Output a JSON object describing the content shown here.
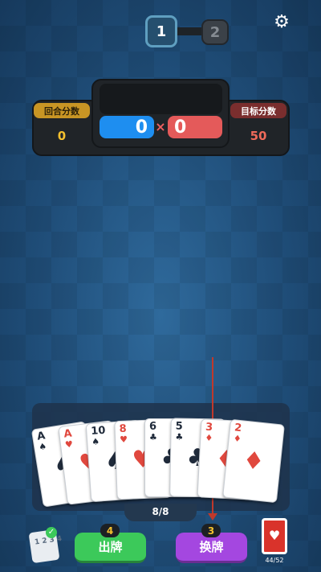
{
  "level": {
    "current": "1",
    "next": "2"
  },
  "settings": {
    "icon": "gear-icon"
  },
  "score": {
    "chips": "0",
    "mult": "0",
    "times_symbol": "×",
    "round_label": "回合分数",
    "round_value": "0",
    "target_label": "目标分数",
    "target_value": "50"
  },
  "hand": {
    "count_text": "8/8",
    "cards": [
      {
        "rank": "A",
        "suit": "♠",
        "color": "black"
      },
      {
        "rank": "A",
        "suit": "♥",
        "color": "red"
      },
      {
        "rank": "10",
        "suit": "♠",
        "color": "black"
      },
      {
        "rank": "8",
        "suit": "♥",
        "color": "red"
      },
      {
        "rank": "6",
        "suit": "♣",
        "color": "black"
      },
      {
        "rank": "5",
        "suit": "♣",
        "color": "black"
      },
      {
        "rank": "3",
        "suit": "♦",
        "color": "red"
      },
      {
        "rank": "2",
        "suit": "♦",
        "color": "red"
      }
    ]
  },
  "actions": {
    "play_label": "出牌",
    "play_remaining": "4",
    "discard_label": "换牌",
    "discard_remaining": "3"
  },
  "sort": {
    "icon": "sort-numbers-icon",
    "text": "1234"
  },
  "deck": {
    "count_text": "44/52",
    "back_symbol": "♥"
  },
  "colors": {
    "background": "#1f4d78",
    "chips": "#1e8ef0",
    "mult": "#e45a5a",
    "play": "#3cc95a",
    "discard": "#a447e0",
    "round_label": "#c89524",
    "target_label": "#7a2e2e"
  }
}
